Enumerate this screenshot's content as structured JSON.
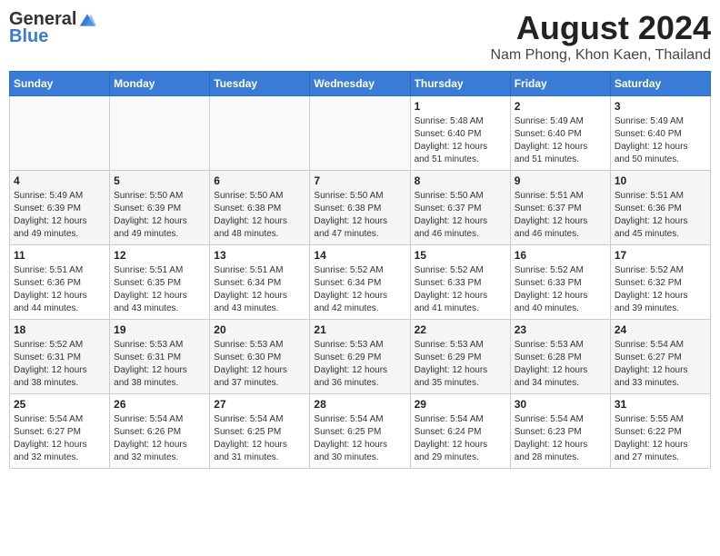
{
  "header": {
    "logo_general": "General",
    "logo_blue": "Blue",
    "month_year": "August 2024",
    "location": "Nam Phong, Khon Kaen, Thailand"
  },
  "days_of_week": [
    "Sunday",
    "Monday",
    "Tuesday",
    "Wednesday",
    "Thursday",
    "Friday",
    "Saturday"
  ],
  "weeks": [
    {
      "days": [
        {
          "num": "",
          "info": ""
        },
        {
          "num": "",
          "info": ""
        },
        {
          "num": "",
          "info": ""
        },
        {
          "num": "",
          "info": ""
        },
        {
          "num": "1",
          "info": "Sunrise: 5:48 AM\nSunset: 6:40 PM\nDaylight: 12 hours\nand 51 minutes."
        },
        {
          "num": "2",
          "info": "Sunrise: 5:49 AM\nSunset: 6:40 PM\nDaylight: 12 hours\nand 51 minutes."
        },
        {
          "num": "3",
          "info": "Sunrise: 5:49 AM\nSunset: 6:40 PM\nDaylight: 12 hours\nand 50 minutes."
        }
      ]
    },
    {
      "days": [
        {
          "num": "4",
          "info": "Sunrise: 5:49 AM\nSunset: 6:39 PM\nDaylight: 12 hours\nand 49 minutes."
        },
        {
          "num": "5",
          "info": "Sunrise: 5:50 AM\nSunset: 6:39 PM\nDaylight: 12 hours\nand 49 minutes."
        },
        {
          "num": "6",
          "info": "Sunrise: 5:50 AM\nSunset: 6:38 PM\nDaylight: 12 hours\nand 48 minutes."
        },
        {
          "num": "7",
          "info": "Sunrise: 5:50 AM\nSunset: 6:38 PM\nDaylight: 12 hours\nand 47 minutes."
        },
        {
          "num": "8",
          "info": "Sunrise: 5:50 AM\nSunset: 6:37 PM\nDaylight: 12 hours\nand 46 minutes."
        },
        {
          "num": "9",
          "info": "Sunrise: 5:51 AM\nSunset: 6:37 PM\nDaylight: 12 hours\nand 46 minutes."
        },
        {
          "num": "10",
          "info": "Sunrise: 5:51 AM\nSunset: 6:36 PM\nDaylight: 12 hours\nand 45 minutes."
        }
      ]
    },
    {
      "days": [
        {
          "num": "11",
          "info": "Sunrise: 5:51 AM\nSunset: 6:36 PM\nDaylight: 12 hours\nand 44 minutes."
        },
        {
          "num": "12",
          "info": "Sunrise: 5:51 AM\nSunset: 6:35 PM\nDaylight: 12 hours\nand 43 minutes."
        },
        {
          "num": "13",
          "info": "Sunrise: 5:51 AM\nSunset: 6:34 PM\nDaylight: 12 hours\nand 43 minutes."
        },
        {
          "num": "14",
          "info": "Sunrise: 5:52 AM\nSunset: 6:34 PM\nDaylight: 12 hours\nand 42 minutes."
        },
        {
          "num": "15",
          "info": "Sunrise: 5:52 AM\nSunset: 6:33 PM\nDaylight: 12 hours\nand 41 minutes."
        },
        {
          "num": "16",
          "info": "Sunrise: 5:52 AM\nSunset: 6:33 PM\nDaylight: 12 hours\nand 40 minutes."
        },
        {
          "num": "17",
          "info": "Sunrise: 5:52 AM\nSunset: 6:32 PM\nDaylight: 12 hours\nand 39 minutes."
        }
      ]
    },
    {
      "days": [
        {
          "num": "18",
          "info": "Sunrise: 5:52 AM\nSunset: 6:31 PM\nDaylight: 12 hours\nand 38 minutes."
        },
        {
          "num": "19",
          "info": "Sunrise: 5:53 AM\nSunset: 6:31 PM\nDaylight: 12 hours\nand 38 minutes."
        },
        {
          "num": "20",
          "info": "Sunrise: 5:53 AM\nSunset: 6:30 PM\nDaylight: 12 hours\nand 37 minutes."
        },
        {
          "num": "21",
          "info": "Sunrise: 5:53 AM\nSunset: 6:29 PM\nDaylight: 12 hours\nand 36 minutes."
        },
        {
          "num": "22",
          "info": "Sunrise: 5:53 AM\nSunset: 6:29 PM\nDaylight: 12 hours\nand 35 minutes."
        },
        {
          "num": "23",
          "info": "Sunrise: 5:53 AM\nSunset: 6:28 PM\nDaylight: 12 hours\nand 34 minutes."
        },
        {
          "num": "24",
          "info": "Sunrise: 5:54 AM\nSunset: 6:27 PM\nDaylight: 12 hours\nand 33 minutes."
        }
      ]
    },
    {
      "days": [
        {
          "num": "25",
          "info": "Sunrise: 5:54 AM\nSunset: 6:27 PM\nDaylight: 12 hours\nand 32 minutes."
        },
        {
          "num": "26",
          "info": "Sunrise: 5:54 AM\nSunset: 6:26 PM\nDaylight: 12 hours\nand 32 minutes."
        },
        {
          "num": "27",
          "info": "Sunrise: 5:54 AM\nSunset: 6:25 PM\nDaylight: 12 hours\nand 31 minutes."
        },
        {
          "num": "28",
          "info": "Sunrise: 5:54 AM\nSunset: 6:25 PM\nDaylight: 12 hours\nand 30 minutes."
        },
        {
          "num": "29",
          "info": "Sunrise: 5:54 AM\nSunset: 6:24 PM\nDaylight: 12 hours\nand 29 minutes."
        },
        {
          "num": "30",
          "info": "Sunrise: 5:54 AM\nSunset: 6:23 PM\nDaylight: 12 hours\nand 28 minutes."
        },
        {
          "num": "31",
          "info": "Sunrise: 5:55 AM\nSunset: 6:22 PM\nDaylight: 12 hours\nand 27 minutes."
        }
      ]
    }
  ]
}
